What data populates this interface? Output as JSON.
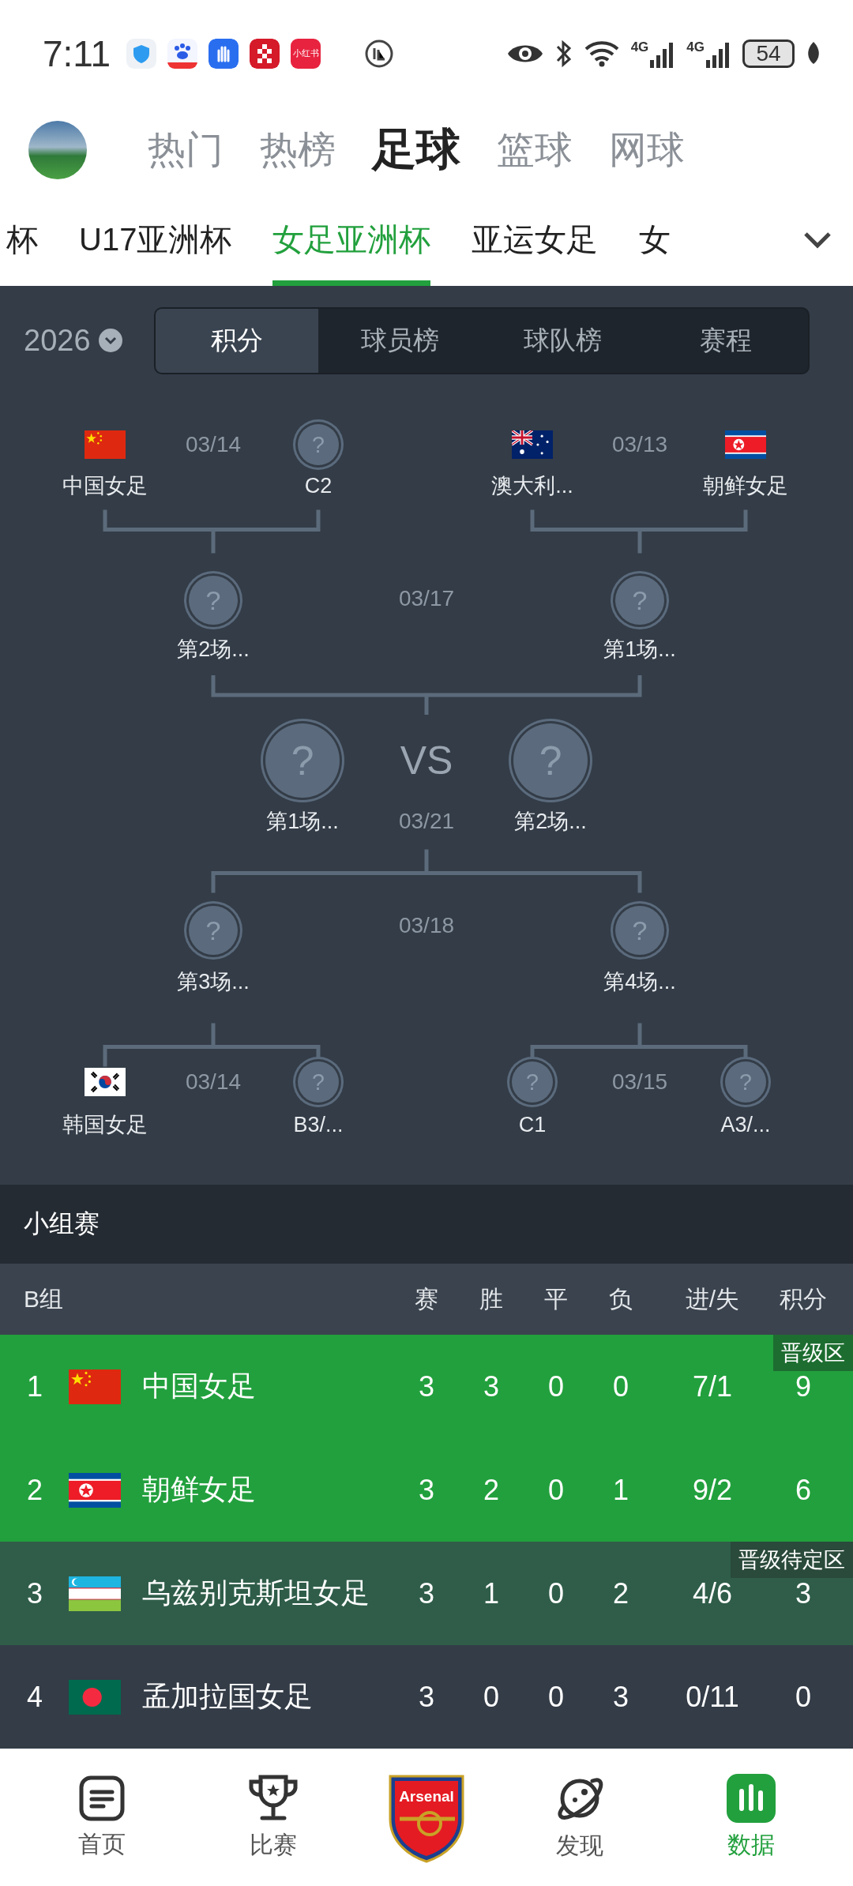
{
  "status_bar": {
    "time": "7:11",
    "app_label": "小红书",
    "network_labels": [
      "4G",
      "4G"
    ],
    "battery": "54"
  },
  "header": {
    "tabs": [
      {
        "label": "热门",
        "selected": false
      },
      {
        "label": "热榜",
        "selected": false
      },
      {
        "label": "足球",
        "selected": true
      },
      {
        "label": "篮球",
        "selected": false
      },
      {
        "label": "网球",
        "selected": false
      }
    ]
  },
  "competition_tabs": [
    {
      "label": "杯",
      "selected": false
    },
    {
      "label": "U17亚洲杯",
      "selected": false
    },
    {
      "label": "女足亚洲杯",
      "selected": true
    },
    {
      "label": "亚运女足",
      "selected": false
    },
    {
      "label": "女",
      "selected": false
    }
  ],
  "season": "2026",
  "view_tabs": [
    {
      "label": "积分",
      "selected": true
    },
    {
      "label": "球员榜",
      "selected": false
    },
    {
      "label": "球队榜",
      "selected": false
    },
    {
      "label": "赛程",
      "selected": false
    }
  ],
  "bracket": {
    "top_quarterfinals": [
      {
        "date": "03/14",
        "teams": [
          {
            "name": "中国女足",
            "kind": "cn"
          },
          {
            "name": "C2",
            "kind": "unknown",
            "mark": "?"
          }
        ]
      },
      {
        "date": "03/13",
        "teams": [
          {
            "name": "澳大利...",
            "kind": "au"
          },
          {
            "name": "朝鲜女足",
            "kind": "kp"
          }
        ]
      }
    ],
    "top_semifinal": {
      "date": "03/17",
      "teams": [
        {
          "name": "第2场...",
          "mark": "?"
        },
        {
          "name": "第1场...",
          "mark": "?"
        }
      ]
    },
    "final": {
      "vs": "VS",
      "date": "03/21",
      "teams": [
        {
          "name": "第1场...",
          "mark": "?"
        },
        {
          "name": "第2场...",
          "mark": "?"
        }
      ]
    },
    "bottom_semifinal": {
      "date": "03/18",
      "teams": [
        {
          "name": "第3场...",
          "mark": "?"
        },
        {
          "name": "第4场...",
          "mark": "?"
        }
      ]
    },
    "bottom_quarterfinals": [
      {
        "date": "03/14",
        "teams": [
          {
            "name": "韩国女足",
            "kind": "kr"
          },
          {
            "name": "B3/...",
            "mark": "?"
          }
        ]
      },
      {
        "date": "03/15",
        "teams": [
          {
            "name": "C1",
            "mark": "?"
          },
          {
            "name": "A3/...",
            "mark": "?"
          }
        ]
      }
    ]
  },
  "group_stage": {
    "title": "小组赛",
    "columns": [
      "B组",
      "赛",
      "胜",
      "平",
      "负",
      "进/失",
      "积分"
    ],
    "rows": [
      {
        "rank": "1",
        "kind": "cn",
        "team": "中国女足",
        "played": "3",
        "won": "3",
        "drawn": "0",
        "lost": "0",
        "goals": "7/1",
        "points": "9",
        "qualified": true,
        "zone_label": "晋级区"
      },
      {
        "rank": "2",
        "kind": "kp",
        "team": "朝鲜女足",
        "played": "3",
        "won": "2",
        "drawn": "0",
        "lost": "1",
        "goals": "9/2",
        "points": "6",
        "qualified": true
      },
      {
        "rank": "3",
        "kind": "uz",
        "team": "乌兹别克斯坦女足",
        "played": "3",
        "won": "1",
        "drawn": "0",
        "lost": "2",
        "goals": "4/6",
        "points": "3",
        "qualified": false,
        "pending": true,
        "zone_label": "晋级待定区"
      },
      {
        "rank": "4",
        "kind": "bd",
        "team": "孟加拉国女足",
        "played": "3",
        "won": "0",
        "drawn": "0",
        "lost": "3",
        "goals": "0/11",
        "points": "0",
        "qualified": false,
        "pending": false
      }
    ]
  },
  "bottom_nav": [
    {
      "kind": "home",
      "label": "首页",
      "selected": false
    },
    {
      "kind": "matches",
      "label": "比赛",
      "selected": false
    },
    {
      "kind": "crest",
      "crest_text": "Arsenal"
    },
    {
      "kind": "discover",
      "label": "发现",
      "selected": false
    },
    {
      "kind": "data",
      "label": "数据",
      "selected": true
    }
  ]
}
